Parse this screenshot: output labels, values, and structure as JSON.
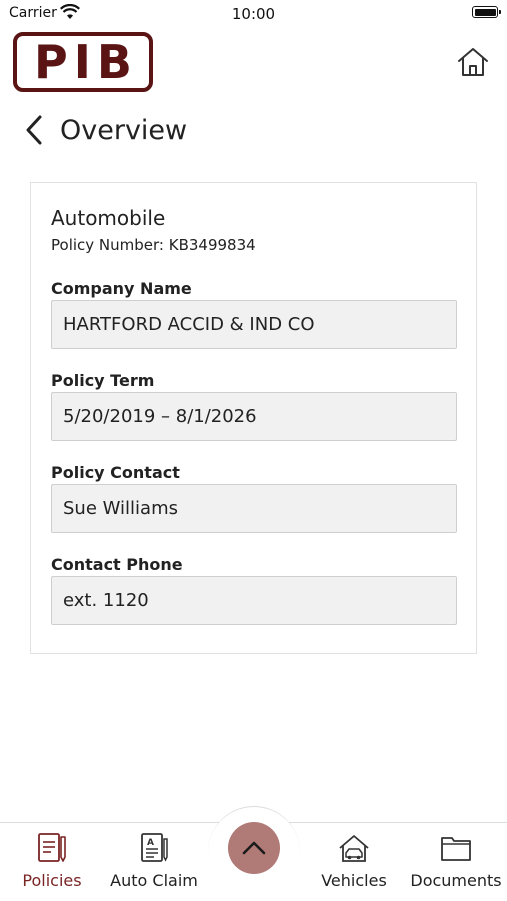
{
  "status_bar": {
    "carrier": "Carrier",
    "time": "10:00"
  },
  "header": {
    "logo_text": "PIB"
  },
  "nav": {
    "back_title": "Overview"
  },
  "policy": {
    "type": "Automobile",
    "number_line": "Policy Number: KB3499834",
    "fields": [
      {
        "label": "Company Name",
        "value": "HARTFORD ACCID & IND CO"
      },
      {
        "label": "Policy Term",
        "value": "5/20/2019 – 8/1/2026"
      },
      {
        "label": "Policy Contact",
        "value": "Sue Williams"
      },
      {
        "label": "Contact Phone",
        "value": "ext. 1120"
      }
    ]
  },
  "tab_bar": {
    "tabs": [
      {
        "label": "Policies",
        "icon": "policies-icon",
        "active": true
      },
      {
        "label": "Auto Claim",
        "icon": "auto-claim-icon",
        "active": false
      },
      {
        "label": "Vehicles",
        "icon": "vehicles-icon",
        "active": false
      },
      {
        "label": "Documents",
        "icon": "documents-icon",
        "active": false
      }
    ],
    "center_button_icon": "chevron-up-icon"
  },
  "colors": {
    "brand": "#5a1414",
    "active_tab": "#7a2424",
    "fab": "#b07a77",
    "field_bg": "#f1f1f1"
  }
}
